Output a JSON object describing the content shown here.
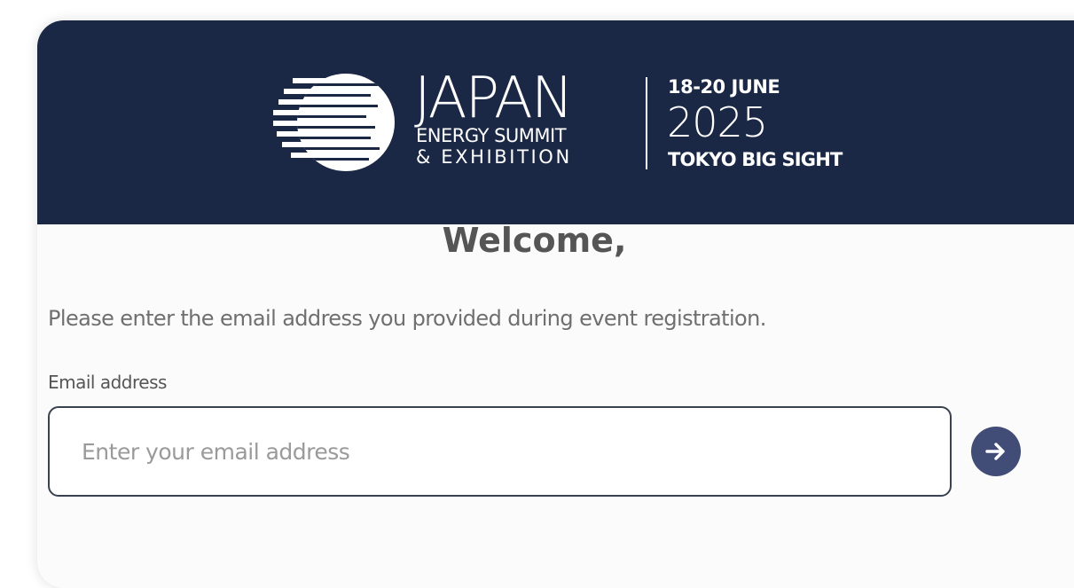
{
  "banner": {
    "brand_name": "JAPAN",
    "brand_line2": "ENERGY SUMMIT",
    "brand_line3": "& EXHIBITION",
    "event_dates": "18-20 JUNE",
    "event_year": "2025",
    "event_venue": "TOKYO BIG SIGHT",
    "background_color": "#1b2845",
    "logo_icon": "striped-circle-logo-icon"
  },
  "form": {
    "title": "Welcome,",
    "instruction": "Please enter the email address you provided during event registration.",
    "email_label": "Email address",
    "email_value": "",
    "email_placeholder": "Enter your email address",
    "submit_icon": "arrow-right-icon",
    "submit_color": "#414c77"
  }
}
